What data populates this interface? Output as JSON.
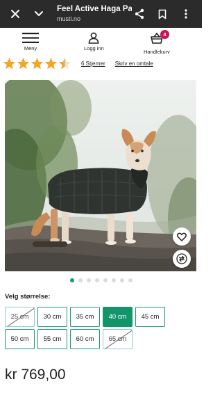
{
  "topbar": {
    "title": "Feel Active Haga Par...",
    "domain": "musti.no",
    "icons": [
      "close-icon",
      "chevron-down-icon",
      "share-icon",
      "bookmark-icon",
      "more-vertical-icon"
    ]
  },
  "header": {
    "menu_label": "Meny",
    "login_label": "Logg inn",
    "cart_label": "Handlekurv",
    "cart_count": "4"
  },
  "rating": {
    "stars_value": 4.5,
    "stars_max": 5,
    "reviews_link": "6 Stjerner",
    "write_review_link": "Skriv en omtale",
    "star_color": "#f5a623"
  },
  "gallery": {
    "image_count": 8,
    "active_index": 0,
    "accent_color": "#12a06c"
  },
  "sizes": {
    "label": "Velg størrelse:",
    "options": [
      {
        "label": "25 cm",
        "state": "unavailable"
      },
      {
        "label": "30 cm",
        "state": "available"
      },
      {
        "label": "35 cm",
        "state": "available"
      },
      {
        "label": "40 cm",
        "state": "selected"
      },
      {
        "label": "45 cm",
        "state": "available"
      },
      {
        "label": "50 cm",
        "state": "available"
      },
      {
        "label": "55 cm",
        "state": "available"
      },
      {
        "label": "60 cm",
        "state": "available"
      },
      {
        "label": "65 cm",
        "state": "unavailable"
      }
    ]
  },
  "price": "kr 769,00"
}
